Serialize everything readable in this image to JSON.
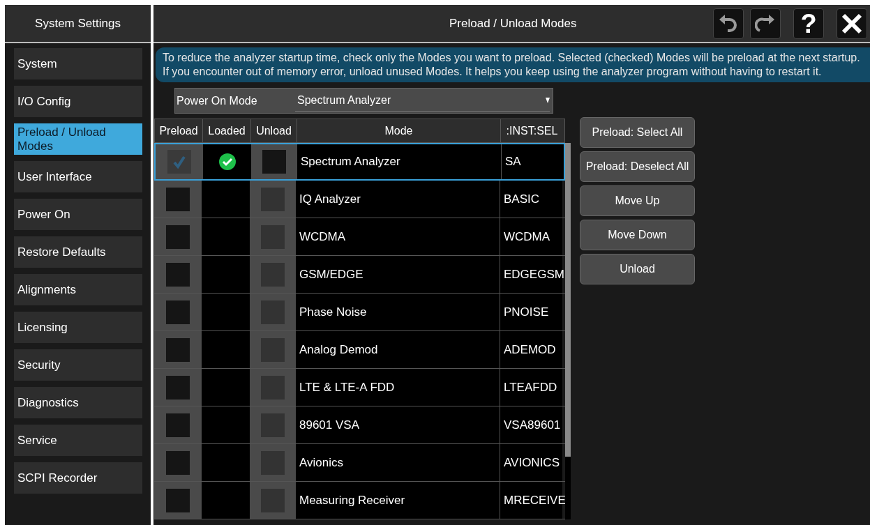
{
  "sidebar": {
    "title": "System Settings",
    "items": [
      {
        "label": "System",
        "selected": false
      },
      {
        "label": "I/O Config",
        "selected": false
      },
      {
        "label": "Preload / Unload Modes",
        "selected": true
      },
      {
        "label": "User Interface",
        "selected": false
      },
      {
        "label": "Power On",
        "selected": false
      },
      {
        "label": "Restore Defaults",
        "selected": false
      },
      {
        "label": "Alignments",
        "selected": false
      },
      {
        "label": "Licensing",
        "selected": false
      },
      {
        "label": "Security",
        "selected": false
      },
      {
        "label": "Diagnostics",
        "selected": false
      },
      {
        "label": "Service",
        "selected": false
      },
      {
        "label": "SCPI Recorder",
        "selected": false
      }
    ]
  },
  "header": {
    "title": "Preload / Unload Modes",
    "help": "?"
  },
  "info": [
    "To reduce the analyzer startup time, check only the Modes you want to preload. Selected (checked) Modes will be preload at the next startup.",
    "If you encounter out of memory error, unload unused Modes. It helps you keep using the analyzer program without having to restart it."
  ],
  "power_on": {
    "label": "Power On Mode",
    "value": "Spectrum Analyzer"
  },
  "table": {
    "columns": [
      "Preload",
      "Loaded",
      "Unload",
      "Mode",
      ":INST:SEL"
    ],
    "rows": [
      {
        "mode": "Spectrum Analyzer",
        "inst": "SA",
        "preload": true,
        "loaded": true,
        "unload_enabled": true,
        "selected": true
      },
      {
        "mode": "IQ Analyzer",
        "inst": "BASIC",
        "preload": false,
        "loaded": false,
        "unload_enabled": false,
        "selected": false
      },
      {
        "mode": "WCDMA",
        "inst": "WCDMA",
        "preload": false,
        "loaded": false,
        "unload_enabled": false,
        "selected": false
      },
      {
        "mode": "GSM/EDGE",
        "inst": "EDGEGSM",
        "preload": false,
        "loaded": false,
        "unload_enabled": false,
        "selected": false
      },
      {
        "mode": "Phase Noise",
        "inst": "PNOISE",
        "preload": false,
        "loaded": false,
        "unload_enabled": false,
        "selected": false
      },
      {
        "mode": "Analog Demod",
        "inst": "ADEMOD",
        "preload": false,
        "loaded": false,
        "unload_enabled": false,
        "selected": false
      },
      {
        "mode": "LTE & LTE-A FDD",
        "inst": "LTEAFDD",
        "preload": false,
        "loaded": false,
        "unload_enabled": false,
        "selected": false
      },
      {
        "mode": "89601 VSA",
        "inst": "VSA89601",
        "preload": false,
        "loaded": false,
        "unload_enabled": false,
        "selected": false
      },
      {
        "mode": "Avionics",
        "inst": "AVIONICS",
        "preload": false,
        "loaded": false,
        "unload_enabled": false,
        "selected": false
      },
      {
        "mode": "Measuring Receiver",
        "inst": "MRECEIVE",
        "preload": false,
        "loaded": false,
        "unload_enabled": false,
        "selected": false
      }
    ]
  },
  "buttons": [
    "Preload: Select All",
    "Preload: Deselect All",
    "Move Up",
    "Move Down",
    "Unload"
  ]
}
